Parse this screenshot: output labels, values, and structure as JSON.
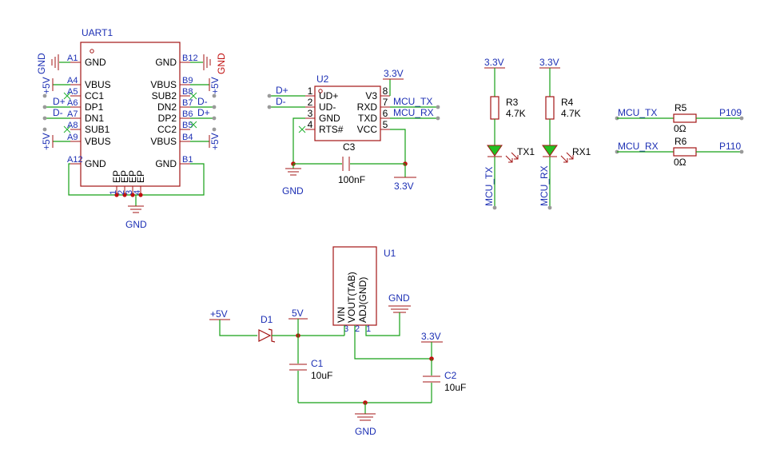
{
  "colors": {
    "wire": "#16a016",
    "symbol": "#a31515",
    "label": "#1c2fb4",
    "junction": "#c01010",
    "background": "#ffffff"
  },
  "uart1": {
    "ref": "UART1",
    "left_pins": [
      {
        "num": "A1",
        "name": "GND",
        "net": "GND"
      },
      {
        "num": "A4",
        "name": "VBUS",
        "net": "+5V"
      },
      {
        "num": "A5",
        "name": "CC1",
        "net": ""
      },
      {
        "num": "A6",
        "name": "DP1",
        "net": "D+"
      },
      {
        "num": "A7",
        "name": "DN1",
        "net": "D-"
      },
      {
        "num": "A8",
        "name": "SUB1",
        "net": ""
      },
      {
        "num": "A9",
        "name": "VBUS",
        "net": "+5V"
      },
      {
        "num": "A12",
        "name": "GND",
        "net": ""
      }
    ],
    "right_pins": [
      {
        "num": "B12",
        "name": "GND",
        "net": "GND"
      },
      {
        "num": "B9",
        "name": "VBUS",
        "net": "+5V"
      },
      {
        "num": "B8",
        "name": "SUB2",
        "net": ""
      },
      {
        "num": "B7",
        "name": "DN2",
        "net": "D-"
      },
      {
        "num": "B6",
        "name": "DP2",
        "net": "D+"
      },
      {
        "num": "B5",
        "name": "CC2",
        "net": ""
      },
      {
        "num": "B4",
        "name": "VBUS",
        "net": "+5V"
      },
      {
        "num": "B1",
        "name": "GND",
        "net": ""
      }
    ],
    "bottom_pins": [
      {
        "num": "1",
        "name": "EP"
      },
      {
        "num": "2",
        "name": "EP"
      },
      {
        "num": "3",
        "name": "EP"
      },
      {
        "num": "4",
        "name": "EP"
      }
    ],
    "gnd_label": "GND"
  },
  "u2": {
    "ref": "U2",
    "left_pins": [
      {
        "num": "1",
        "name": "UD+",
        "net": "D+"
      },
      {
        "num": "2",
        "name": "UD-",
        "net": "D-"
      },
      {
        "num": "3",
        "name": "GND",
        "net": ""
      },
      {
        "num": "4",
        "name": "RTS#",
        "net": ""
      }
    ],
    "right_pins": [
      {
        "num": "8",
        "name": "V3",
        "net": "3.3V"
      },
      {
        "num": "7",
        "name": "RXD",
        "net": "MCU_TX"
      },
      {
        "num": "6",
        "name": "TXD",
        "net": "MCU_RX"
      },
      {
        "num": "5",
        "name": "VCC",
        "net": ""
      }
    ],
    "c3_ref": "C3",
    "c3_value": "100nF",
    "gnd_label": "GND",
    "vcc_label": "3.3V"
  },
  "leds": [
    {
      "ref": "R3",
      "value": "4.7K",
      "supply": "3.3V",
      "led_ref": "TX1",
      "net": "MCU_TX"
    },
    {
      "ref": "R4",
      "value": "4.7K",
      "supply": "3.3V",
      "led_ref": "RX1",
      "net": "MCU_RX"
    }
  ],
  "resistors": [
    {
      "ref": "R5",
      "value": "0Ω",
      "net_in": "MCU_TX",
      "net_out": "P109"
    },
    {
      "ref": "R6",
      "value": "0Ω",
      "net_in": "MCU_RX",
      "net_out": "P110"
    }
  ],
  "regulator": {
    "ref": "U1",
    "pins": [
      {
        "num": "3",
        "name": "VIN"
      },
      {
        "num": "2",
        "name": "VOUT(TAB)"
      },
      {
        "num": "1",
        "name": "ADJ(GND)"
      }
    ],
    "input_label": "+5V",
    "diode_ref": "D1",
    "node_label": "5V",
    "c1_ref": "C1",
    "c1_value": "10uF",
    "c2_ref": "C2",
    "c2_value": "10uF",
    "out_label": "3.3V",
    "gnd_top": "GND",
    "gnd_bottom": "GND"
  }
}
